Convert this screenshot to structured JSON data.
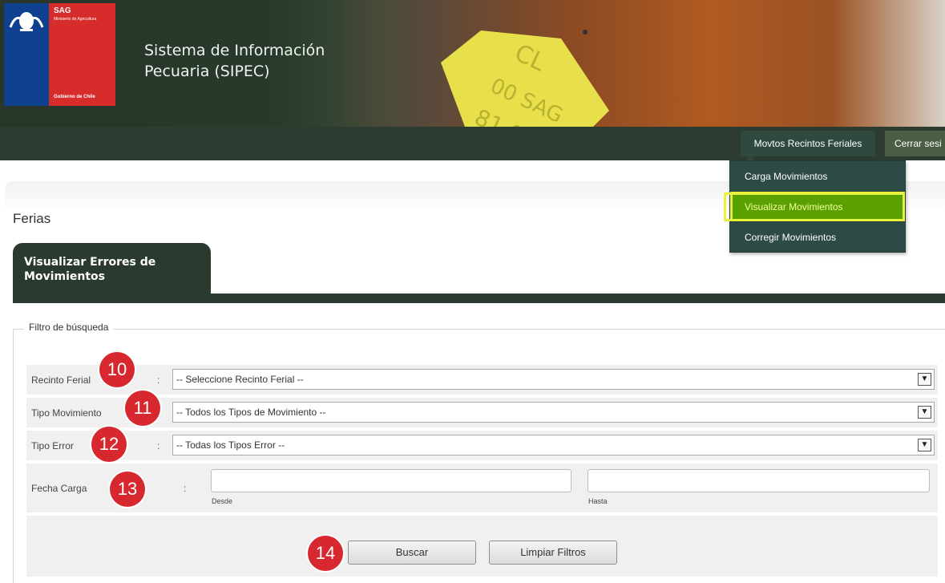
{
  "header": {
    "logo_org": "SAG",
    "logo_ministry": "Ministerio de Agricultura",
    "logo_gov": "Gobierno de Chile",
    "app_title": "Sistema de Información Pecuaria (SIPEC)"
  },
  "nav": {
    "active_menu": "Movtos Recintos Feriales",
    "logout": "Cerrar sesi"
  },
  "dropdown": {
    "items": [
      {
        "label": "Carga Movimientos"
      },
      {
        "label": "Visualizar Movimientos"
      },
      {
        "label": "Corregir Movimientos"
      }
    ],
    "highlighted_index": 1,
    "highlight_color": "#5aa000"
  },
  "page": {
    "section_title": "Ferias",
    "tab_label": "Visualizar Errores de Movimientos"
  },
  "filter": {
    "legend": "Filtro de búsqueda",
    "rows": [
      {
        "label": "Recinto Ferial",
        "colon": ":",
        "value": "-- Seleccione Recinto Ferial --",
        "badge": "10"
      },
      {
        "label": "Tipo Movimiento",
        "colon": ":",
        "value": "-- Todos los Tipos de Movimiento --",
        "badge": "11"
      },
      {
        "label": "Tipo Error",
        "colon": ":",
        "value": "-- Todas los Tipos Error --",
        "badge": "12"
      }
    ],
    "date": {
      "label": "Fecha Carga",
      "colon": ":",
      "from_label": "Desde",
      "to_label": "Hasta",
      "from_value": "",
      "to_value": "",
      "badge": "13"
    },
    "buttons": {
      "search": "Buscar",
      "clear": "Limpiar Filtros",
      "badge": "14"
    }
  },
  "colors": {
    "navbar": "#2d3b31",
    "tab": "#2a3a2e",
    "badge": "#d8282f",
    "highlight_outline": "#e8f43a"
  }
}
